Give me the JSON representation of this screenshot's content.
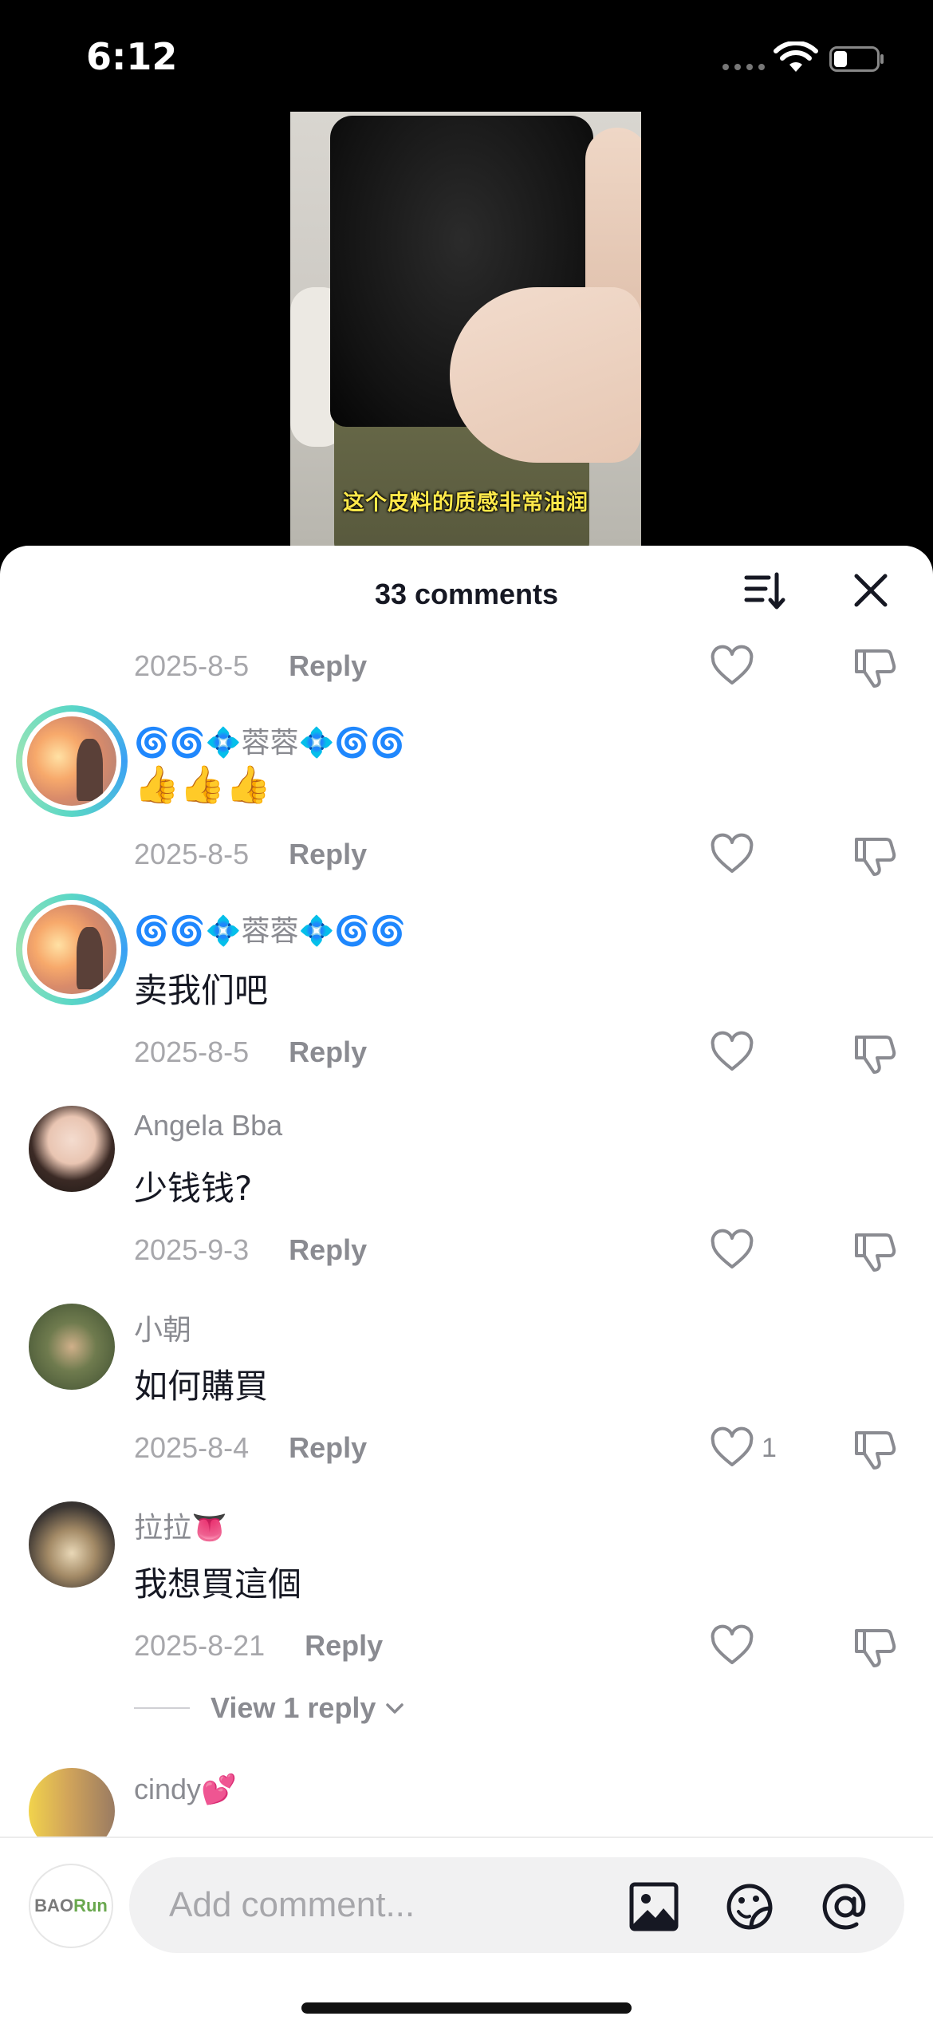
{
  "status_bar": {
    "time": "6:12"
  },
  "video": {
    "caption": "这个皮料的质感非常油润"
  },
  "sheet": {
    "title": "33 comments",
    "icons": {
      "sort": "sort-icon",
      "close": "close-icon"
    }
  },
  "comments": [
    {
      "date": "2025-8-5",
      "reply": "Reply"
    },
    {
      "username": "🌀🌀💠蓉蓉💠🌀🌀",
      "text": "👍👍👍",
      "date": "2025-8-5",
      "reply": "Reply"
    },
    {
      "username": "🌀🌀💠蓉蓉💠🌀🌀",
      "text": "卖我们吧",
      "date": "2025-8-5",
      "reply": "Reply"
    },
    {
      "username": "Angela Bba",
      "text": "少钱钱?",
      "date": "2025-9-3",
      "reply": "Reply"
    },
    {
      "username": "小朝",
      "text": "如何購買",
      "date": "2025-8-4",
      "reply": "Reply",
      "likes": "1"
    },
    {
      "username": "拉拉👅",
      "text": "我想買這個",
      "date": "2025-8-21",
      "reply": "Reply",
      "view_replies": "View 1 reply"
    },
    {
      "username": "cindy💕"
    }
  ],
  "bottom_bar": {
    "logo_text_1": "BAO",
    "logo_text_2": "Run",
    "input_placeholder": "Add comment..."
  },
  "colors": {
    "accent_ring": "#3aa0f5",
    "meta_gray": "#8a8b91",
    "caption_yellow": "#ffe94a"
  }
}
